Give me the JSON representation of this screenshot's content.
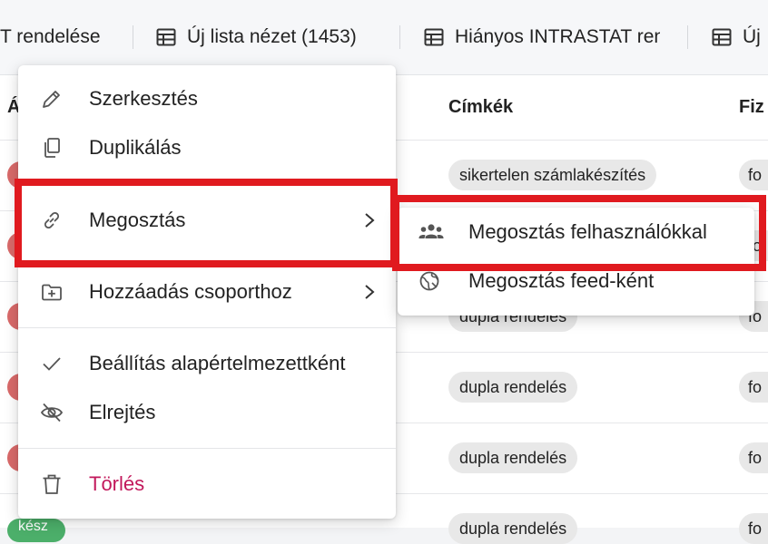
{
  "tabs": [
    {
      "label": "T rendelése"
    },
    {
      "label": "Új lista nézet (1453)"
    },
    {
      "label": "Hiányos INTRASTAT rendelések"
    },
    {
      "label": "Új"
    }
  ],
  "table": {
    "headers": [
      "Á",
      "Címkék",
      "Fiz"
    ],
    "rows": [
      {
        "tag": "sikertelen számlakészítés",
        "pay": "fo"
      },
      {
        "tag": "",
        "pay": "fo"
      },
      {
        "tag": "dupla rendelés",
        "pay": "fo"
      },
      {
        "tag": "dupla rendelés",
        "pay": "fo"
      },
      {
        "tag": "dupla rendelés",
        "pay": "fo"
      },
      {
        "tag": "dupla rendelés",
        "pay": "fo"
      }
    ],
    "status_badge": "kész"
  },
  "context_menu": {
    "items": [
      {
        "label": "Szerkesztés",
        "icon": "pencil-icon"
      },
      {
        "label": "Duplikálás",
        "icon": "copy-icon"
      },
      {
        "label": "Megosztás",
        "icon": "link-icon"
      },
      {
        "label": "Hozzáadás csoporthoz",
        "icon": "folder-plus-icon"
      },
      {
        "label": "Beállítás alapértelmezettként",
        "icon": "check-icon"
      },
      {
        "label": "Elrejtés",
        "icon": "eye-off-icon"
      },
      {
        "label": "Törlés",
        "icon": "trash-icon"
      }
    ],
    "delete_color": "#c2185b"
  },
  "submenu": {
    "items": [
      {
        "label": "Megosztás felhasználókkal",
        "icon": "users-icon"
      },
      {
        "label": "Megosztás feed-ként",
        "icon": "globe-icon"
      }
    ]
  },
  "highlight_color": "#e01a1f"
}
